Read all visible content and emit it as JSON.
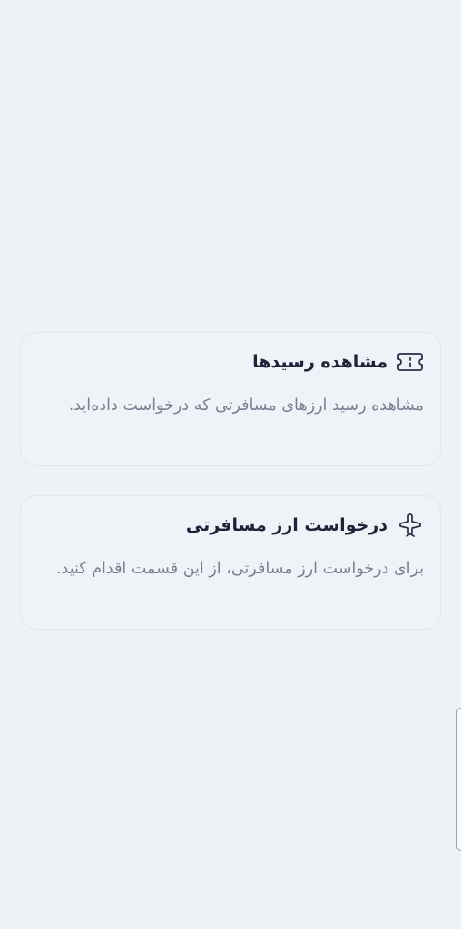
{
  "cards": [
    {
      "icon": "ticket-icon",
      "title": "مشاهده رسیدها",
      "description": "مشاهده رسید ارزهای مسافرتی که درخواست داده‌اید."
    },
    {
      "icon": "airplane-icon",
      "title": "درخواست ارز مسافرتی",
      "description": "برای درخواست ارز مسافرتی، از این قسمت اقدام کنید."
    }
  ]
}
